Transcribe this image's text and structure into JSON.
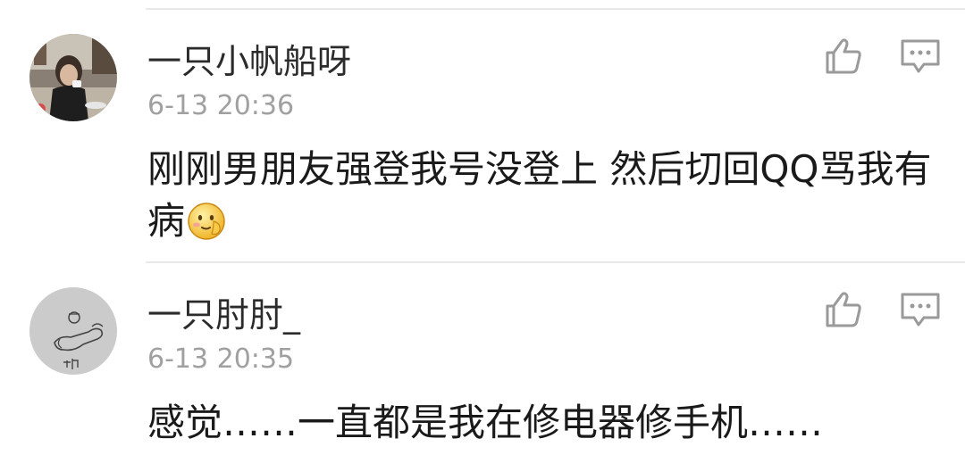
{
  "comments": [
    {
      "username": "一只小帆船呀",
      "time": "6-13 20:36",
      "text": "刚刚男朋友强登我号没登上 然后切回QQ骂我有病",
      "emoji": "shy-smile-emoji"
    },
    {
      "username": "一只肘肘_",
      "time": "6-13 20:35",
      "text": "感觉……一直都是我在修电器修手机……"
    }
  ],
  "icons": {
    "like": "thumbs-up-icon",
    "reply": "comment-bubble-icon"
  },
  "colors": {
    "username": "#2b2b2b",
    "timestamp": "#a0a0a0",
    "text": "#1a1a1a",
    "icon": "#9a9a9a",
    "divider": "#e8e8e8"
  }
}
